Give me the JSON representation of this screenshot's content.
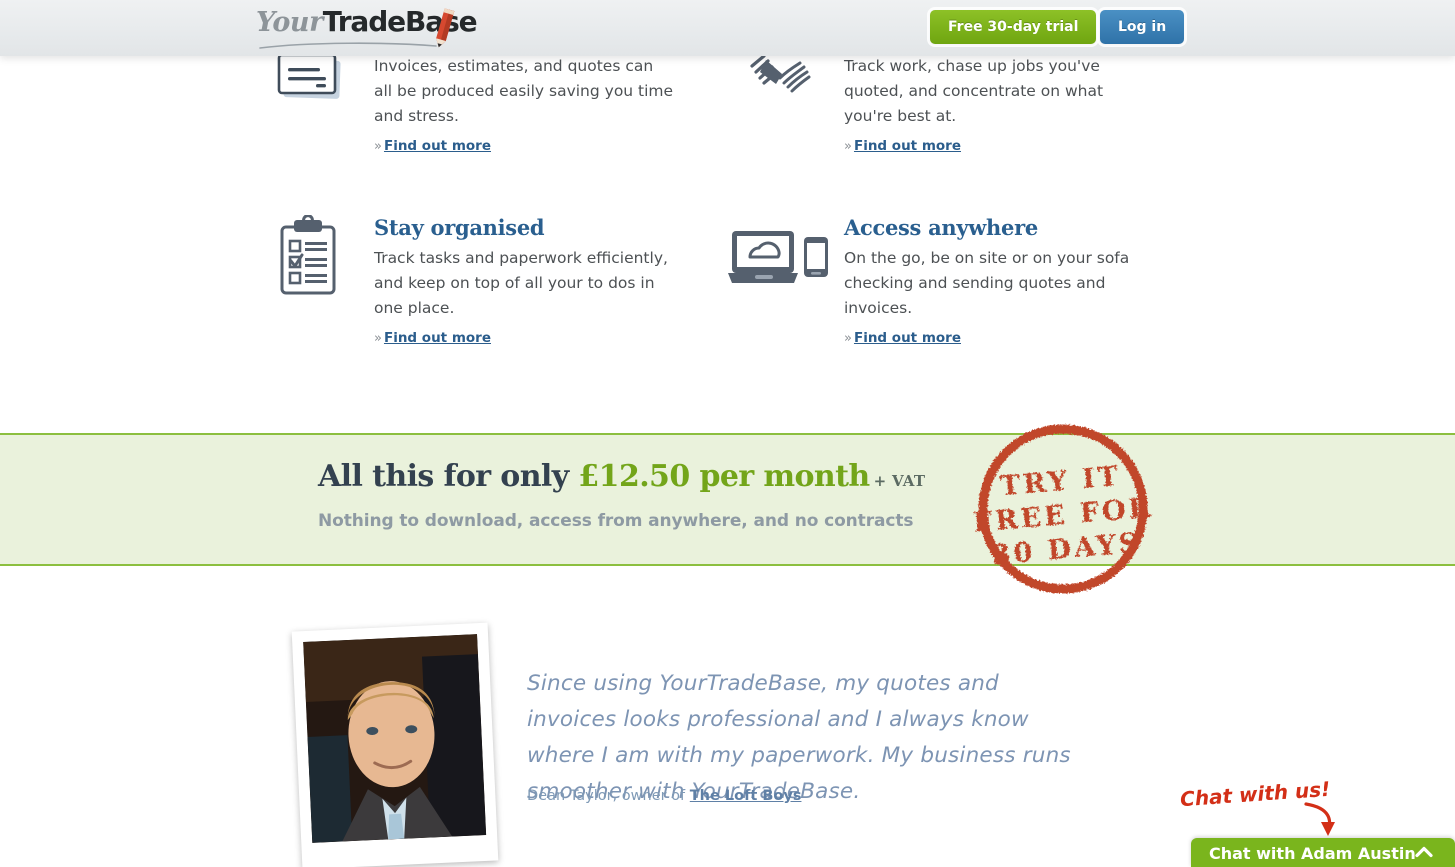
{
  "header": {
    "logo": {
      "part1": "Your",
      "part2": "TradeBase",
      "icon": "pencil-icon"
    },
    "trial_button": "Free 30-day trial",
    "login_button": "Log in"
  },
  "features": [
    {
      "id": "invoices",
      "icon": "documents-stack-icon",
      "title": "",
      "body": "Invoices, estimates, and quotes can all be produced easily saving you time and stress.",
      "link": "Find out more",
      "link_prefix": "»"
    },
    {
      "id": "track",
      "icon": "handshake-icon",
      "title": "",
      "body": "Track work, chase up jobs you've quoted, and concentrate on what you're best at.",
      "link": "Find out more",
      "link_prefix": "»"
    },
    {
      "id": "organise",
      "icon": "clipboard-checklist-icon",
      "title": "Stay organised",
      "body": "Track tasks and paperwork efficiently, and keep on top of all your to dos in one place.",
      "link": "Find out more",
      "link_prefix": "»"
    },
    {
      "id": "access",
      "icon": "laptop-cloud-phone-icon",
      "title": "Access anywhere",
      "body": "On the go, be on site or on your sofa checking and sending quotes and invoices.",
      "link": "Find out more",
      "link_prefix": "»"
    }
  ],
  "price_band": {
    "lead": "All this for only",
    "amount": "£12.50 per month",
    "vat": "+ VAT",
    "subtext": "Nothing to download, access from anywhere, and no contracts",
    "background": "#eaf2dc",
    "border_color": "#8cbf3f",
    "amount_color": "#73a51a"
  },
  "stamp": {
    "line1": "TRY IT",
    "line2": "FREE FOR",
    "line3": "30 DAYS",
    "color": "#c1472c"
  },
  "testimonial": {
    "quote": "Since using YourTradeBase, my quotes and invoices looks professional and I always know where I am with my paperwork. My business runs smoother with YourTradeBase.",
    "attrib_prefix": "Dean Taylor, owner of ",
    "company": "The Loft Boys",
    "photo_alt": "portrait-photo"
  },
  "chat": {
    "call_to_action": "Chat with us!",
    "bar_label": "Chat with Adam Austin",
    "chevron": "chevron-up-icon",
    "bar_color": "#7ab51d",
    "cta_color": "#d32f17"
  }
}
